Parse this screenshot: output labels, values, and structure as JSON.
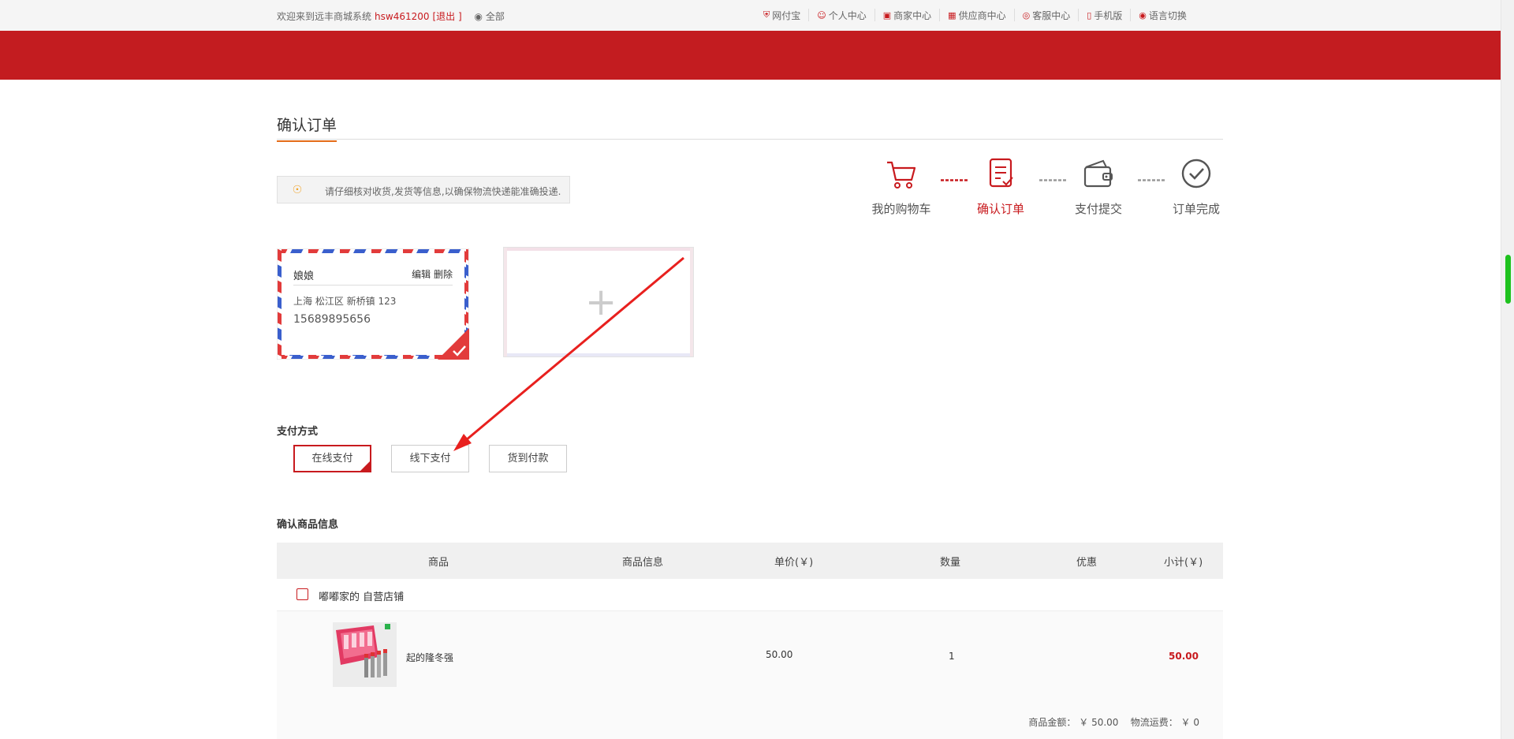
{
  "topbar": {
    "welcome": "欢迎来到远丰商城系统",
    "username": "hsw461200",
    "logout": "[退出 ]",
    "location": "全部",
    "nav": [
      {
        "label": "网付宝",
        "icon": "shield-icon"
      },
      {
        "label": "个人中心",
        "icon": "user-icon"
      },
      {
        "label": "商家中心",
        "icon": "store-icon"
      },
      {
        "label": "供应商中心",
        "icon": "supplier-icon"
      },
      {
        "label": "客服中心",
        "icon": "headset-icon"
      },
      {
        "label": "手机版",
        "icon": "phone-icon"
      },
      {
        "label": "语言切换",
        "icon": "language-icon"
      }
    ]
  },
  "page": {
    "title": "确认订单",
    "tip": "请仔细核对收货,发货等信息,以确保物流快递能准确投递."
  },
  "steps": [
    {
      "label": "我的购物车",
      "icon": "cart-icon",
      "state": "done"
    },
    {
      "label": "确认订单",
      "icon": "order-icon",
      "state": "active"
    },
    {
      "label": "支付提交",
      "icon": "wallet-icon",
      "state": "pending"
    },
    {
      "label": "订单完成",
      "icon": "check-circle-icon",
      "state": "pending"
    }
  ],
  "address": {
    "name": "娘娘",
    "edit": "编辑",
    "delete": "删除",
    "address": "上海 松江区 新桥镇 123",
    "phone": "15689895656",
    "add_symbol": "+"
  },
  "payment": {
    "title": "支付方式",
    "options": [
      "在线支付",
      "线下支付",
      "货到付款"
    ],
    "selected": "在线支付"
  },
  "goods": {
    "title": "确认商品信息",
    "headers": [
      "商品",
      "商品信息",
      "单价(￥)",
      "数量",
      "优惠",
      "小计(￥)"
    ],
    "shop_name": "嘟嘟家的 自营店铺",
    "items": [
      {
        "name": "起的隆冬强",
        "price": "50.00",
        "quantity": "1",
        "discount": "",
        "subtotal": "50.00"
      }
    ],
    "totals": {
      "goods_amount_label": "商品金额：",
      "goods_amount": "￥ 50.00",
      "shipping_label": "物流运费：",
      "shipping": "￥ 0"
    }
  },
  "colors": {
    "brand_red": "#c31c20",
    "accent_orange": "#e46c19",
    "scroll_green": "#1ec21e"
  }
}
